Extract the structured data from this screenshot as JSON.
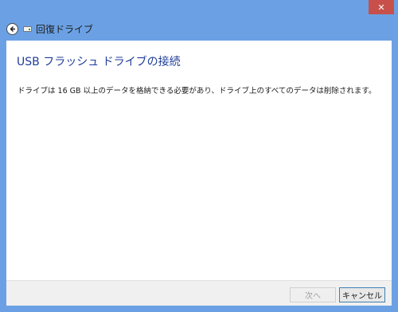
{
  "window": {
    "close_symbol": "✕"
  },
  "titlebar": {
    "back_icon": "back-arrow-icon",
    "drive_icon": "usb-drive-icon",
    "title": "回復ドライブ"
  },
  "main": {
    "heading": "USB フラッシュ ドライブの接続",
    "description": "ドライブは 16 GB 以上のデータを格納できる必要があり、ドライブ上のすべてのデータは削除されます。"
  },
  "footer": {
    "next_label": "次へ",
    "next_enabled": false,
    "cancel_label": "キャンセル"
  },
  "colors": {
    "frame": "#6ba1e4",
    "close": "#c7504b",
    "heading": "#1f3d99"
  }
}
